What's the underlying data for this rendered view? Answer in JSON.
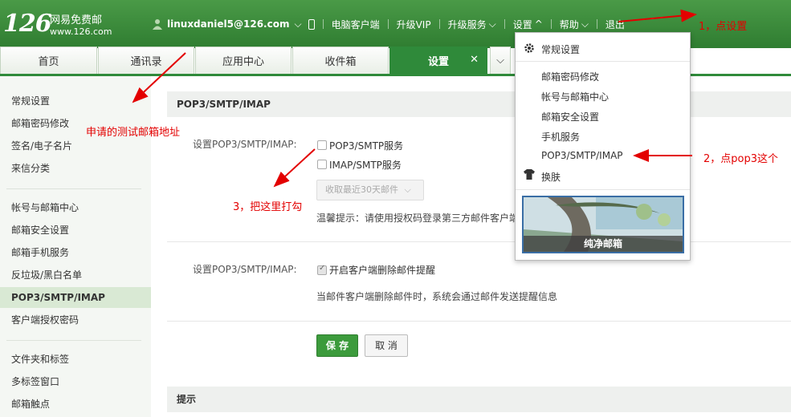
{
  "header": {
    "logo_num": "126",
    "logo_text": "网易免费邮",
    "logo_url": "www.126.com",
    "user": "linuxdaniel5@126.com",
    "nav": [
      "电脑客户端",
      "升级VIP",
      "升级服务",
      "设置",
      "帮助",
      "退出"
    ]
  },
  "tabs": [
    "首页",
    "通讯录",
    "应用中心",
    "收件箱",
    "设置"
  ],
  "sidebar": {
    "items": [
      "常规设置",
      "邮箱密码修改",
      "签名/电子名片",
      "来信分类",
      "帐号与邮箱中心",
      "邮箱安全设置",
      "邮箱手机服务",
      "反垃圾/黑白名单",
      "POP3/SMTP/IMAP",
      "客户端授权密码",
      "文件夹和标签",
      "多标签窗口",
      "邮箱触点"
    ]
  },
  "main": {
    "section_title": "POP3/SMTP/IMAP",
    "label1": "设置POP3/SMTP/IMAP:",
    "cb_pop3": "POP3/SMTP服务",
    "cb_imap": "IMAP/SMTP服务",
    "select_value": "收取最近30天邮件",
    "hint": "温馨提示：请使用授权码登录第三方邮件客户端",
    "label2": "设置POP3/SMTP/IMAP:",
    "cb_delete": "开启客户端删除邮件提醒",
    "delete_hint": "当邮件客户端删除邮件时，系统会通过邮件发送提醒信息",
    "save": "保 存",
    "cancel": "取 消",
    "tips_title": "提示"
  },
  "dropdown": {
    "head": "常规设置",
    "items": [
      "邮箱密码修改",
      "帐号与邮箱中心",
      "邮箱安全设置",
      "手机服务",
      "POP3/SMTP/IMAP"
    ],
    "skin": "换肤",
    "skin_caption": "纯净邮箱"
  },
  "annotations": {
    "a1": "1，点设置",
    "a2": "2，点pop3这个",
    "a3": "3，把这里打勾",
    "a4": "申请的测试邮箱地址"
  },
  "colors": {
    "brand_green": "#2f8a3a",
    "annotation_red": "#e30000"
  }
}
